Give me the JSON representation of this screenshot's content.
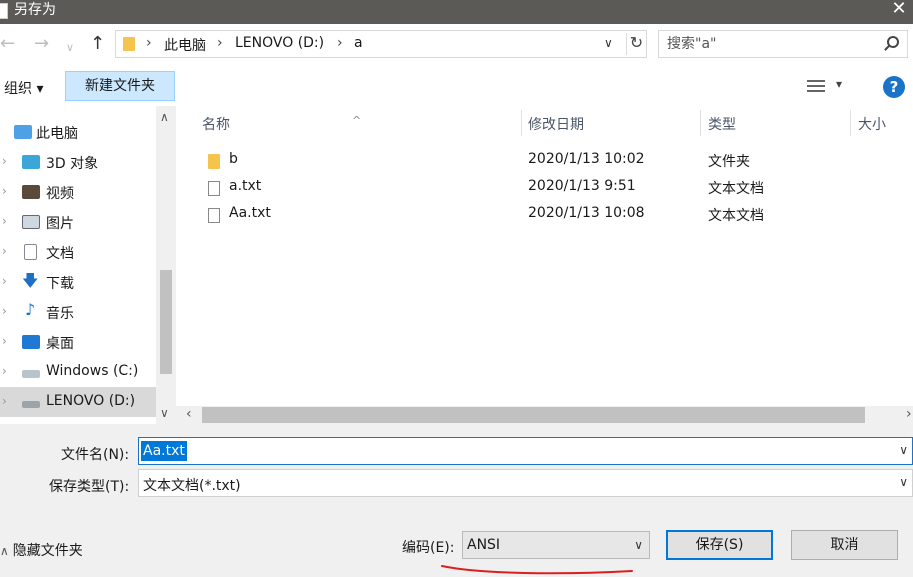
{
  "window": {
    "title": "另存为",
    "close_label": "✕"
  },
  "address_bar": {
    "breadcrumb": [
      "此电脑",
      "LENOVO (D:)",
      "a"
    ],
    "separator": "›"
  },
  "search": {
    "placeholder": "搜索\"a\""
  },
  "toolbar": {
    "organize_label": "组织 ▾",
    "new_folder_label": "新建文件夹",
    "help_label": "?"
  },
  "tree": {
    "items": [
      {
        "label": "此电脑",
        "icon": "computer-icon"
      },
      {
        "label": "3D 对象",
        "icon": "cube-icon"
      },
      {
        "label": "视频",
        "icon": "video-icon"
      },
      {
        "label": "图片",
        "icon": "picture-icon"
      },
      {
        "label": "文档",
        "icon": "document-icon"
      },
      {
        "label": "下载",
        "icon": "download-arrow-icon"
      },
      {
        "label": "音乐",
        "icon": "music-note-icon"
      },
      {
        "label": "桌面",
        "icon": "desktop-icon"
      },
      {
        "label": "Windows (C:)",
        "icon": "drive-icon"
      },
      {
        "label": "LENOVO (D:)",
        "icon": "drive-icon",
        "selected": true
      }
    ]
  },
  "file_list": {
    "columns": [
      "名称",
      "修改日期",
      "类型",
      "大小"
    ],
    "rows": [
      {
        "name": "b",
        "date": "2020/1/13 10:02",
        "type": "文件夹",
        "icon": "folder-icon"
      },
      {
        "name": "a.txt",
        "date": "2020/1/13 9:51",
        "type": "文本文档",
        "icon": "text-file-icon"
      },
      {
        "name": "Aa.txt",
        "date": "2020/1/13 10:08",
        "type": "文本文档",
        "icon": "text-file-icon"
      }
    ]
  },
  "form": {
    "filename_label": "文件名(N):",
    "filename_value": "Aa.txt",
    "filetype_label": "保存类型(T):",
    "filetype_value": "文本文档(*.txt)",
    "hide_folders_label": "隐藏文件夹",
    "encoding_label": "编码(E):",
    "encoding_value": "ANSI",
    "save_label": "保存(S)",
    "cancel_label": "取消"
  },
  "colors": {
    "accent": "#0078d7",
    "annotation": "#d92020",
    "new_folder_bg": "#cce8ff"
  }
}
